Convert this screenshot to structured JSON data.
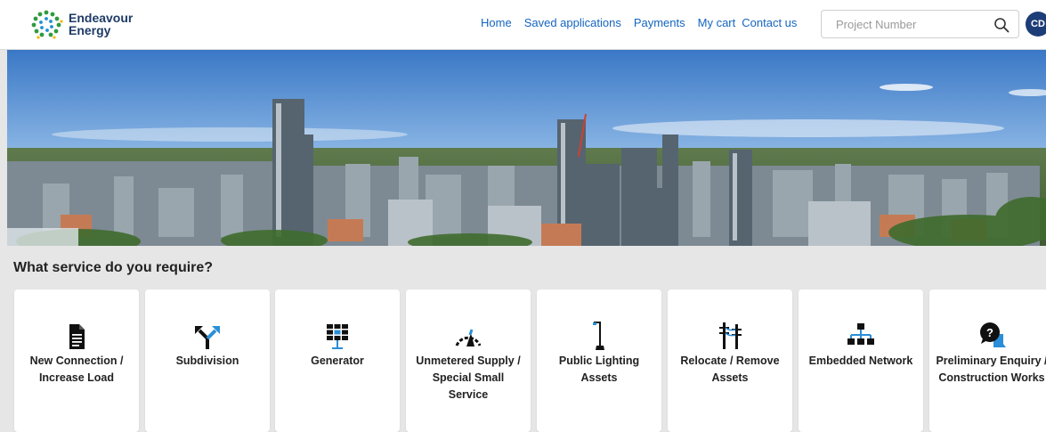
{
  "header": {
    "logo_line1": "Endeavour",
    "logo_line2": "Energy",
    "nav": [
      "Home",
      "Saved applications",
      "Payments",
      "My cart",
      "Contact us"
    ],
    "search_placeholder": "Project Number",
    "search_value": "",
    "avatar_initials": "CD"
  },
  "main": {
    "section_title": "What service do you require?",
    "services": [
      {
        "label": "New Connection / Increase Load",
        "icon": "document-icon"
      },
      {
        "label": "Subdivision",
        "icon": "split-arrow-icon"
      },
      {
        "label": "Generator",
        "icon": "solar-panel-icon"
      },
      {
        "label": "Unmetered Supply / Special Small Service",
        "icon": "gauge-icon"
      },
      {
        "label": "Public Lighting Assets",
        "icon": "street-light-icon"
      },
      {
        "label": "Relocate / Remove Assets",
        "icon": "power-pole-icon"
      },
      {
        "label": "Embedded Network",
        "icon": "network-hierarchy-icon"
      },
      {
        "label": "Preliminary Enquiry / Construction Works",
        "icon": "question-chat-icon"
      }
    ]
  },
  "colors": {
    "brand_navy": "#1d3d78",
    "link_blue": "#1565c0",
    "logo_green": "#2e9b3e",
    "icon_accent_blue": "#2a8fd8"
  }
}
